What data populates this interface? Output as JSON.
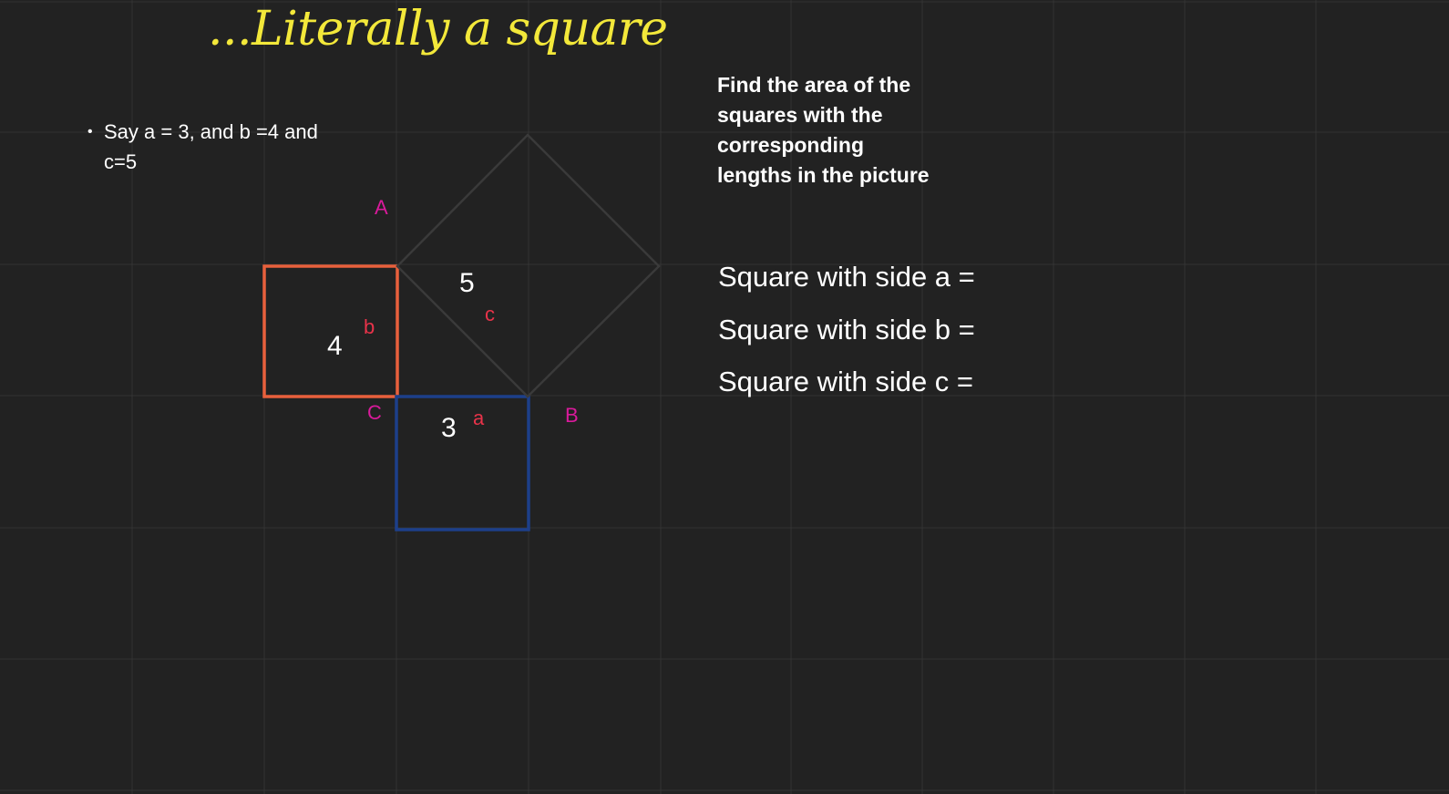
{
  "title": "...Literally a square",
  "bullet": {
    "symbol": "•",
    "text": "Say a = 3, and b =4 and c=5"
  },
  "prompt": "Find the area of the squares with the corresponding lengths in the picture",
  "questions": [
    "Square with side a =",
    "Square with side b =",
    "Square with side c ="
  ],
  "diagram": {
    "vertices": {
      "A": "A",
      "B": "B",
      "C": "C"
    },
    "sides": {
      "a": "a",
      "b": "b",
      "c": "c"
    },
    "lengths": {
      "a": "3",
      "b": "4",
      "c": "5"
    }
  },
  "colors": {
    "background": "#222222",
    "title": "#f3e83a",
    "square_b": "#e8603c",
    "square_a": "#1d3f8a",
    "square_c": "#3a3a3a",
    "side_label": "#e8334a",
    "vertex_label": "#d91a9b"
  }
}
